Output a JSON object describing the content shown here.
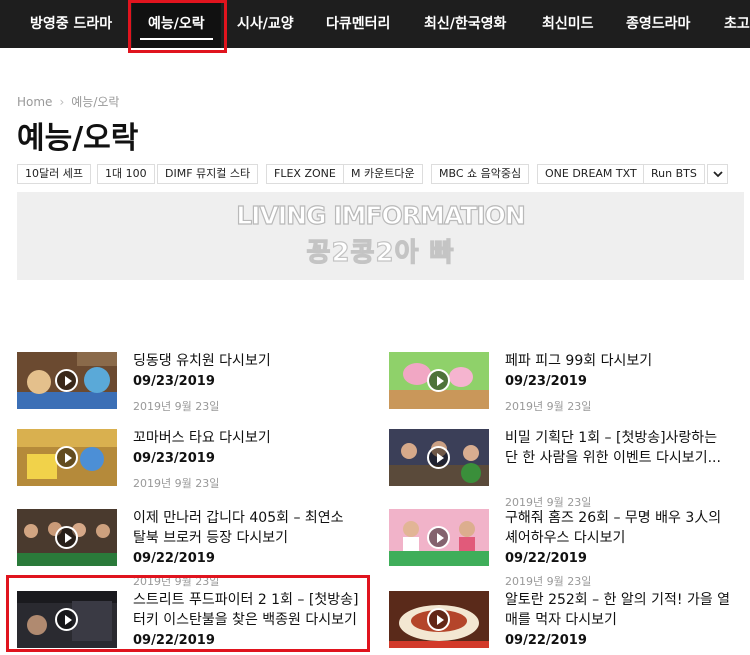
{
  "nav": {
    "items": [
      {
        "label": "방영중 드라마",
        "active": false
      },
      {
        "label": "예능/오락",
        "active": true
      },
      {
        "label": "시사/교양",
        "active": false
      },
      {
        "label": "다큐멘터리",
        "active": false
      },
      {
        "label": "최신/한국영화",
        "active": false
      },
      {
        "label": "최신미드",
        "active": false
      },
      {
        "label": "종영드라마",
        "active": false
      },
      {
        "label": "초고",
        "active": false
      }
    ]
  },
  "breadcrumb": {
    "home": "Home",
    "current": "예능/오락"
  },
  "page_title": "예능/오락",
  "tags": [
    "10달러 세프",
    "1대 100",
    "DIMF 뮤지컬 스타",
    "FLEX ZONE",
    "M 카운트다운",
    "MBC 쇼 음악중심",
    "ONE DREAM TXT",
    "Run BTS"
  ],
  "banner": {
    "line1": "LIVING IMFORMATION",
    "line2": "꽁2콩2아 빠"
  },
  "posts": [
    {
      "title": "딩동댕 유치원 다시보기",
      "date": "09/23/2019",
      "meta": "2019년 9월 23일"
    },
    {
      "title": "페파 피그 99회 다시보기",
      "date": "09/23/2019",
      "meta": "2019년 9월 23일"
    },
    {
      "title": "꼬마버스 타요 다시보기",
      "date": "09/23/2019",
      "meta": "2019년 9월 23일"
    },
    {
      "title": "비밀 기획단 1회 – [첫방송]사랑하는 단 한 사람을 위한 이벤트 다시보기...",
      "date": "",
      "meta": "2019년 9월 23일"
    },
    {
      "title": "이제 만나러 갑니다 405회 – 최연소 탈북 브로커 등장 다시보기",
      "date": "09/22/2019",
      "meta": "2019년 9월 23일"
    },
    {
      "title": "구해줘 홈즈 26회 – 무명 배우 3人의 셰어하우스 다시보기",
      "date": "09/22/2019",
      "meta": "2019년 9월 23일"
    },
    {
      "title": "스트리트 푸드파이터 2 1회 – [첫방송]터키 이스탄불을 찾은 백종원 다시보기",
      "date": "09/22/2019",
      "meta": ""
    },
    {
      "title": "알토란 252회 – 한 알의 기적! 가을 열매를 먹자 다시보기",
      "date": "09/22/2019",
      "meta": ""
    }
  ]
}
